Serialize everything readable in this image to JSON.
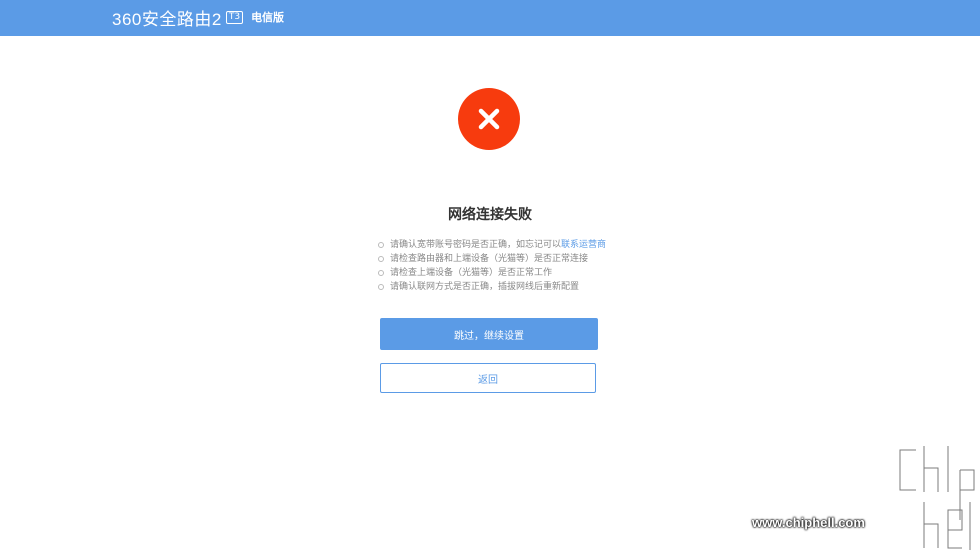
{
  "header": {
    "logo": "360安全路由2",
    "model_badge": "T3",
    "edition": "电信版",
    "bg_color": "#5b9be6"
  },
  "status": {
    "icon": "close-icon",
    "color": "#f73b0e",
    "title": "网络连接失败"
  },
  "tips": [
    {
      "text": "请确认宽带账号密码是否正确，如忘记可以",
      "link": "联系运营商"
    },
    {
      "text": "请检查路由器和上端设备（光猫等）是否正常连接",
      "link": ""
    },
    {
      "text": "请检查上端设备（光猫等）是否正常工作",
      "link": ""
    },
    {
      "text": "请确认联网方式是否正确，插拔网线后重新配置",
      "link": ""
    }
  ],
  "buttons": {
    "skip": "跳过，继续设置",
    "back": "返回"
  },
  "watermark": {
    "url": "www.chiphell.com"
  }
}
